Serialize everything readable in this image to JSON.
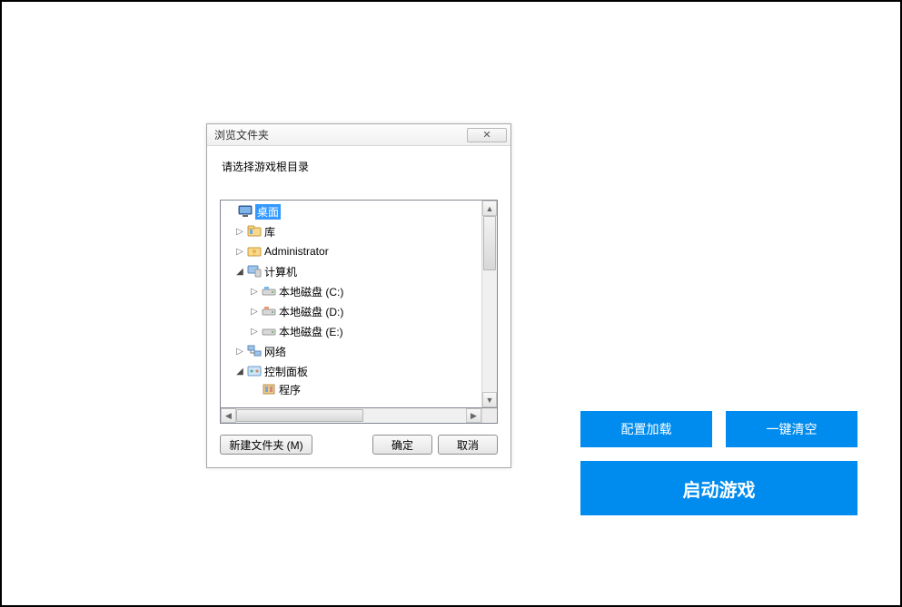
{
  "dialog": {
    "title": "浏览文件夹",
    "close_x": "✕",
    "prompt": "请选择游戏根目录",
    "buttons": {
      "new_folder": "新建文件夹 (M)",
      "ok": "确定",
      "cancel": "取消"
    }
  },
  "tree": {
    "desktop": "桌面",
    "libraries": "库",
    "user": "Administrator",
    "computer": "计算机",
    "drive_c": "本地磁盘 (C:)",
    "drive_d": "本地磁盘 (D:)",
    "drive_e": "本地磁盘 (E:)",
    "network": "网络",
    "control_panel": "控制面板",
    "programs": "程序"
  },
  "right": {
    "config_load": "配置加载",
    "clear_all": "一键清空",
    "launch": "启动游戏"
  }
}
